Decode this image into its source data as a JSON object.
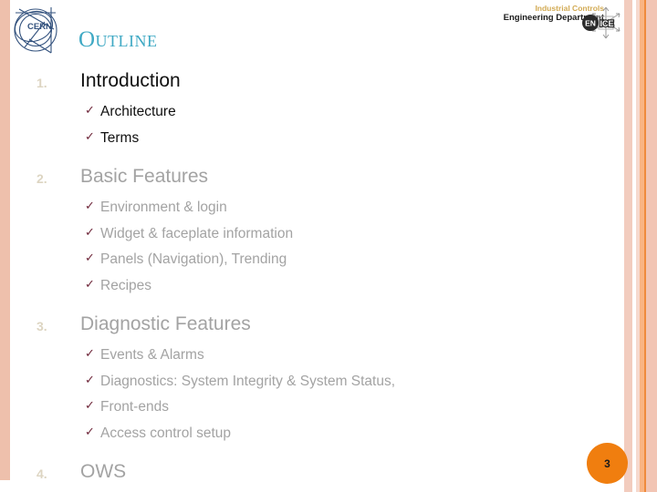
{
  "slide": {
    "title": "Outline",
    "page_number": "3",
    "accent_color": "#3fa9c4",
    "badge_color": "#f07e0f",
    "number_color": "#ddd5c2",
    "check_color": "#6e2639",
    "edge_bar_color": "#eec0ac"
  },
  "header": {
    "cern_logo_label": "CERN",
    "cern_logo_text": "CERN",
    "department": {
      "line1": "Industrial Controls",
      "line2": "Engineering Department",
      "line1_color": "#d2aa53",
      "line2_color": "#1a1a1a"
    },
    "enice_logo": {
      "badge_text": "EN",
      "snowflake_text": "ICE"
    }
  },
  "outline": {
    "sections": [
      {
        "number": "1.",
        "title": "Introduction",
        "tone": "dark",
        "items": [
          "Architecture",
          "Terms"
        ]
      },
      {
        "number": "2.",
        "title": "Basic Features",
        "tone": "grey",
        "items": [
          "Environment & login",
          "Widget  & faceplate information",
          "Panels (Navigation), Trending",
          "Recipes"
        ]
      },
      {
        "number": "3.",
        "title": "Diagnostic Features",
        "tone": "grey",
        "items": [
          "Events & Alarms",
          "Diagnostics: System Integrity & System Status,",
          "Front-ends",
          "Access control setup"
        ]
      },
      {
        "number": "4.",
        "title": "OWS",
        "tone": "grey",
        "items": []
      }
    ],
    "bullet_glyph": "✓"
  }
}
